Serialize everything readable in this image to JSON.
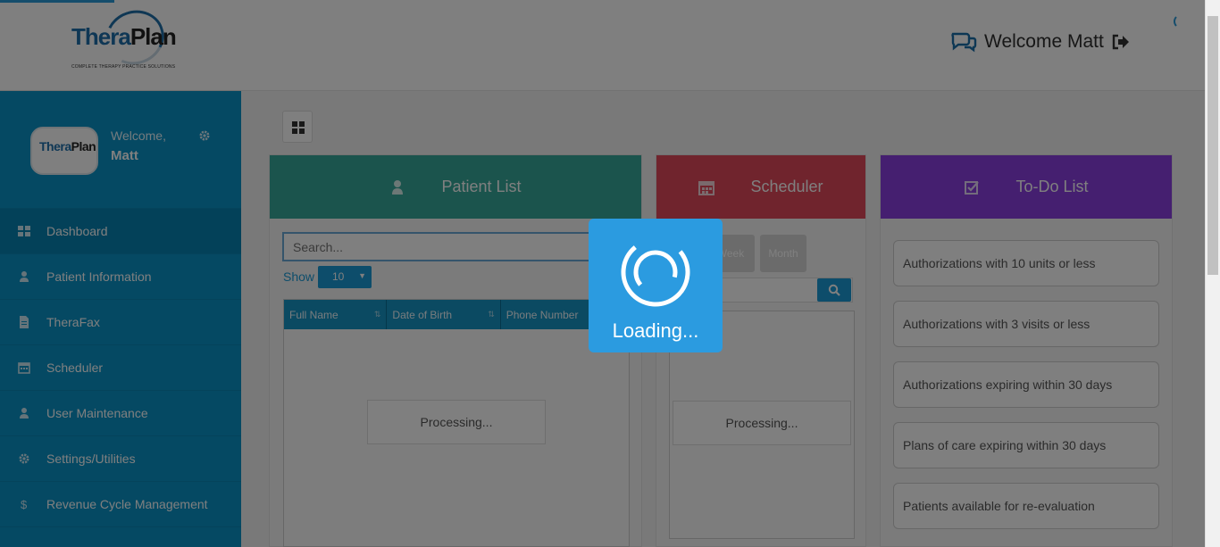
{
  "header": {
    "logo_part1": "Thera",
    "logo_part2": "Plan",
    "logo_tagline": "COMPLETE THERAPY PRACTICE SOLUTIONS",
    "welcome": "Welcome Matt"
  },
  "sidebar": {
    "welcome": "Welcome,",
    "username": "Matt",
    "items": [
      {
        "label": "Dashboard",
        "icon": "dashboard-icon"
      },
      {
        "label": "Patient Information",
        "icon": "user-icon"
      },
      {
        "label": "TheraFax",
        "icon": "document-icon"
      },
      {
        "label": "Scheduler",
        "icon": "calendar-icon"
      },
      {
        "label": "User Maintenance",
        "icon": "user-cog-icon"
      },
      {
        "label": "Settings/Utilities",
        "icon": "gear-icon"
      },
      {
        "label": "Revenue Cycle Management",
        "icon": "dollar-icon"
      }
    ]
  },
  "patient_list": {
    "title": "Patient List",
    "search_placeholder": "Search...",
    "show_label": "Show",
    "show_value": "10",
    "columns": [
      "Full Name",
      "Date of Birth",
      "Phone Number"
    ],
    "processing": "Processing..."
  },
  "scheduler": {
    "title": "Scheduler",
    "week": "Week",
    "month": "Month",
    "search_text": "...",
    "processing": "Processing..."
  },
  "todo": {
    "title": "To-Do List",
    "items": [
      "Authorizations with 10 units or less",
      "Authorizations with 3 visits or less",
      "Authorizations expiring within 30 days",
      "Plans of care expiring within 30 days",
      "Patients available for re-evaluation"
    ]
  },
  "loading": {
    "text": "Loading..."
  },
  "colors": {
    "sidebar": "#0b93c7",
    "patient_list": "#36a89b",
    "scheduler": "#e1495b",
    "todo": "#8b3ee0",
    "loading": "#2b9be0"
  }
}
